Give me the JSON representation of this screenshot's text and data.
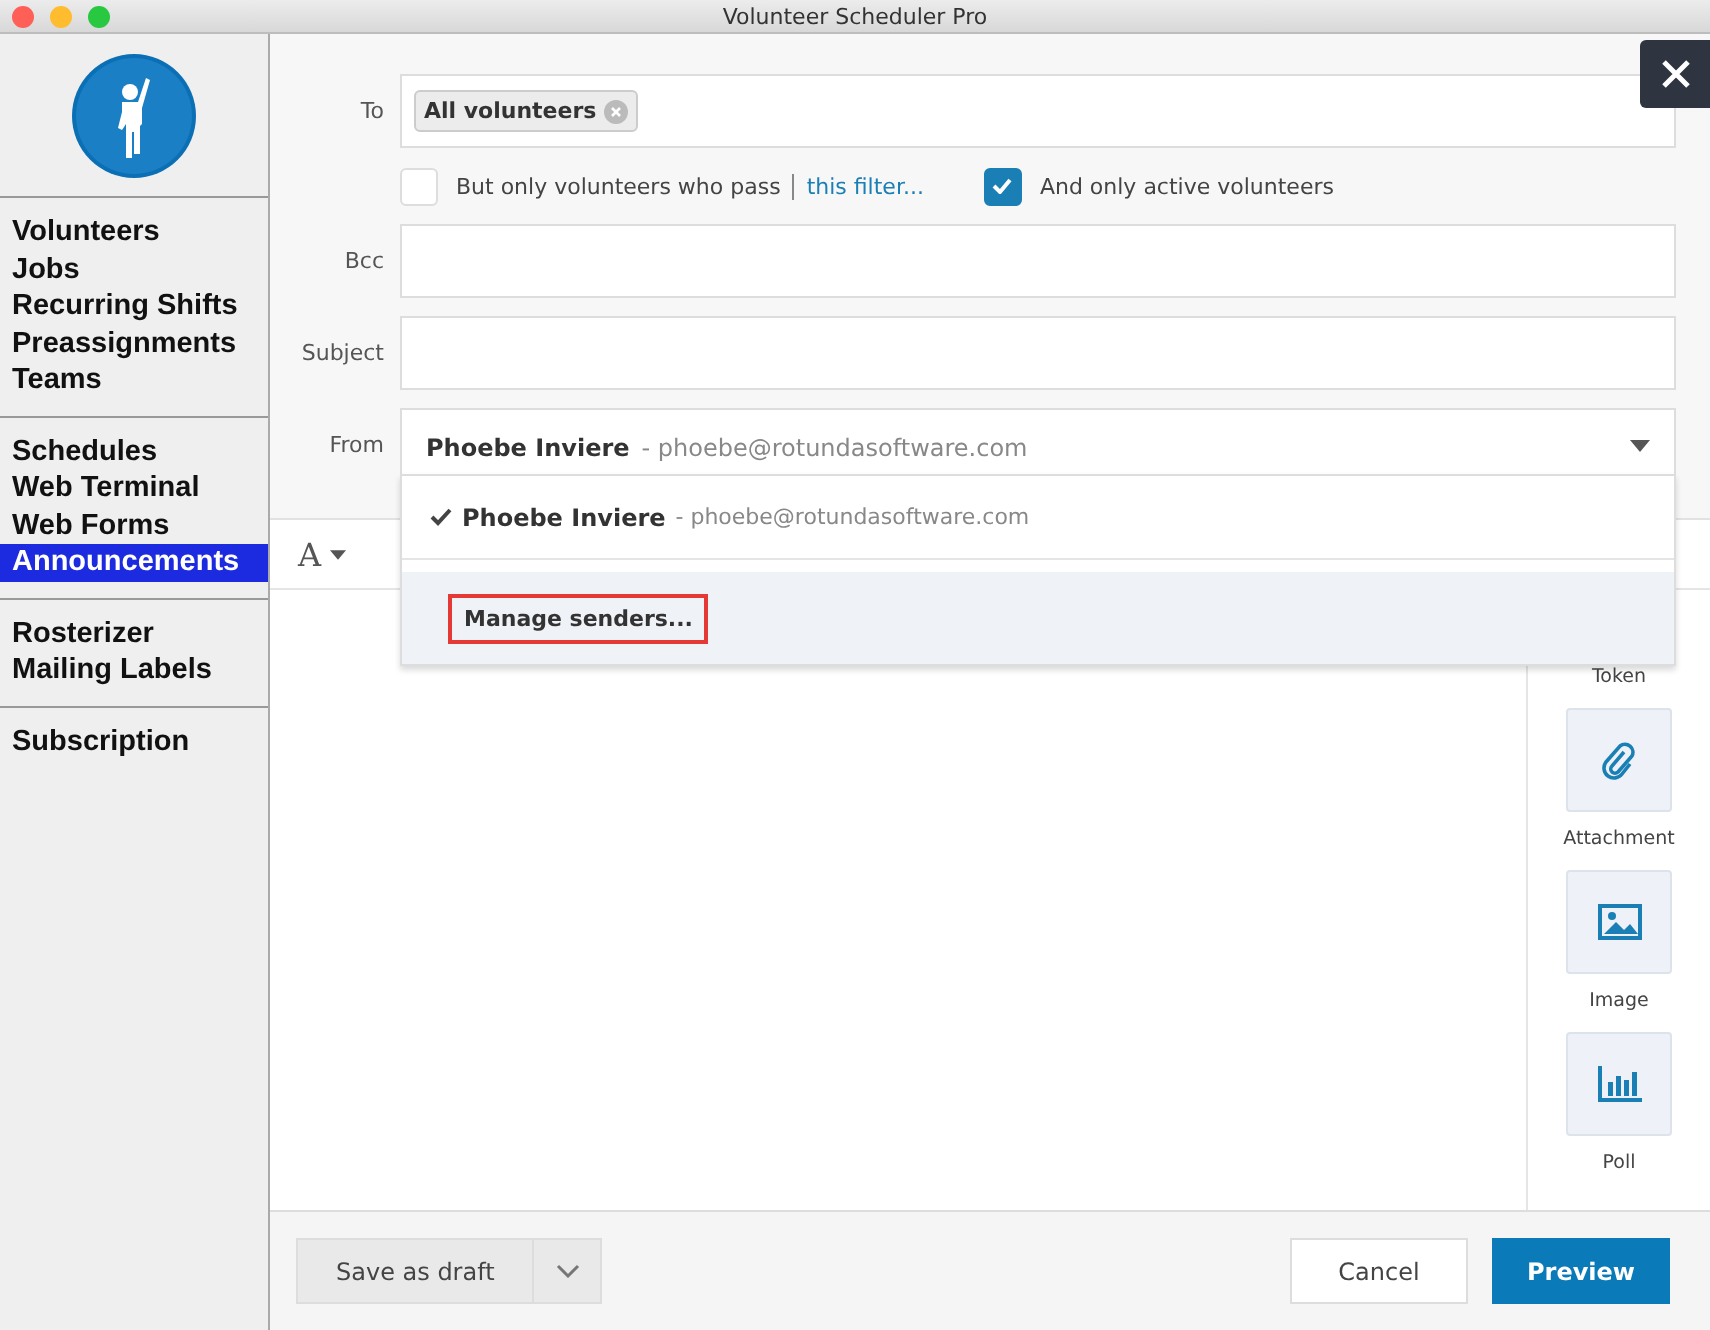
{
  "window": {
    "title": "Volunteer Scheduler Pro"
  },
  "sidebar": {
    "groups": [
      {
        "items": [
          {
            "label": "Volunteers",
            "selected": false
          },
          {
            "label": "Jobs",
            "selected": false
          },
          {
            "label": "Recurring Shifts",
            "selected": false
          },
          {
            "label": "Preassignments",
            "selected": false
          },
          {
            "label": "Teams",
            "selected": false
          }
        ]
      },
      {
        "items": [
          {
            "label": "Schedules",
            "selected": false
          },
          {
            "label": "Web Terminal",
            "selected": false
          },
          {
            "label": "Web Forms",
            "selected": false
          },
          {
            "label": "Announcements",
            "selected": true
          }
        ]
      },
      {
        "items": [
          {
            "label": "Rosterizer",
            "selected": false
          },
          {
            "label": "Mailing Labels",
            "selected": false
          }
        ]
      },
      {
        "items": [
          {
            "label": "Subscription",
            "selected": false
          }
        ]
      }
    ]
  },
  "form": {
    "to": {
      "label": "To",
      "tags": [
        "All volunteers"
      ]
    },
    "filters": [
      {
        "label": "But only volunteers who pass",
        "link": "this filter...",
        "checked": false
      },
      {
        "label": "And only active volunteers",
        "checked": true
      }
    ],
    "bcc": {
      "label": "Bcc"
    },
    "subject": {
      "label": "Subject"
    },
    "from": {
      "label": "From",
      "name": "Phoebe Inviere",
      "email": "- phoebe@rotundasoftware.com"
    }
  },
  "from_menu": {
    "options": [
      {
        "name": "Phoebe Inviere",
        "email": "- phoebe@rotundasoftware.com",
        "checked": true
      }
    ],
    "manage": "Manage senders..."
  },
  "editor_toolbar": {
    "font_button": "A"
  },
  "insert_panel": [
    {
      "kind": "token",
      "label": "Token"
    },
    {
      "kind": "attachment",
      "label": "Attachment"
    },
    {
      "kind": "image",
      "label": "Image"
    },
    {
      "kind": "poll",
      "label": "Poll"
    }
  ],
  "footer": {
    "save": "Save as draft",
    "cancel": "Cancel",
    "preview": "Preview"
  }
}
